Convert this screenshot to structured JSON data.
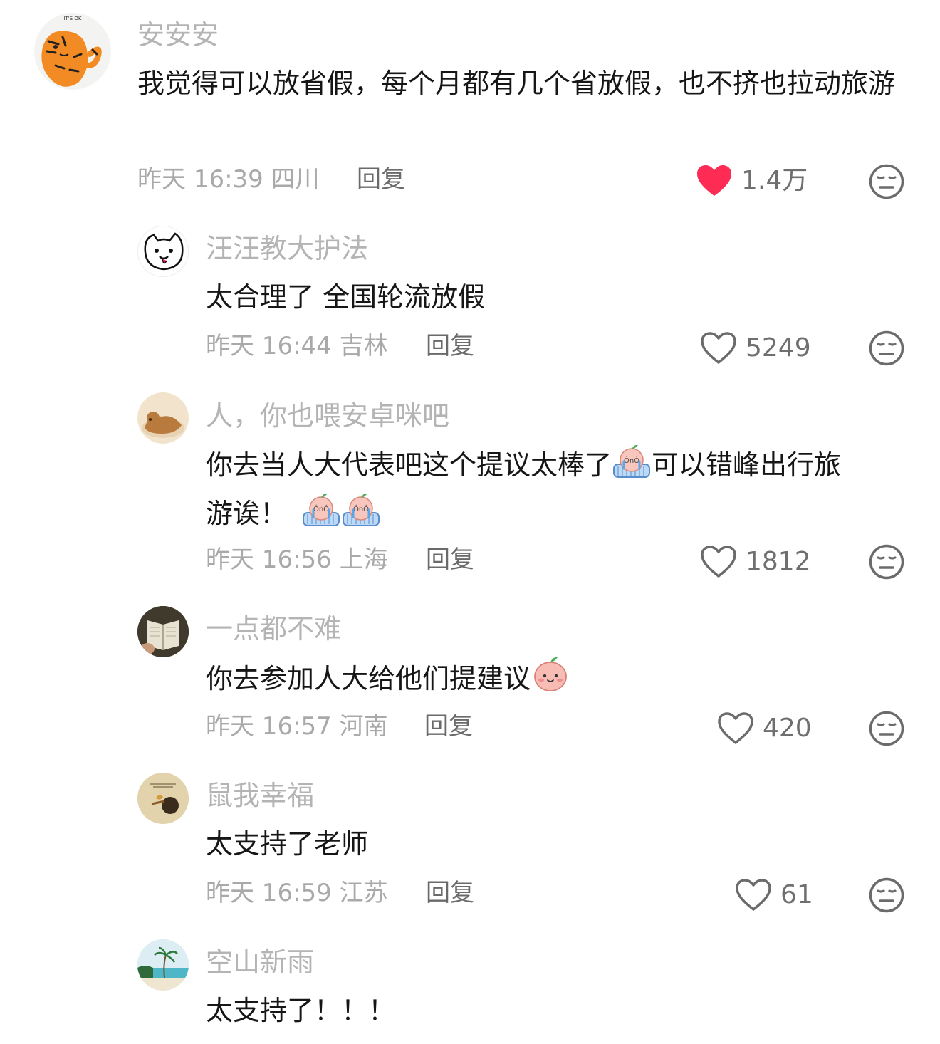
{
  "comments": [
    {
      "username": "安安安",
      "text": "我觉得可以放省假，每个月都有几个省放假，也不挤也拉动旅游",
      "time": "昨天 16:39",
      "location": "四川",
      "reply_label": "回复",
      "likes": "1.4万",
      "liked": true,
      "avatar_text": "IT'S OK"
    },
    {
      "username": "汪汪教大护法",
      "text": "太合理了 全国轮流放假",
      "time": "昨天 16:44",
      "location": "吉林",
      "reply_label": "回复",
      "likes": "5249",
      "liked": false
    },
    {
      "username": "人，你也喂安卓咪吧",
      "text_a": "你去当人大代表吧这个提议太棒了",
      "text_b": "可以错峰出行旅",
      "text_c": "游诶！",
      "time": "昨天 16:56",
      "location": "上海",
      "reply_label": "回复",
      "likes": "1812",
      "liked": false
    },
    {
      "username": "一点都不难",
      "text": "你去参加人大给他们提建议",
      "time": "昨天 16:57",
      "location": "河南",
      "reply_label": "回复",
      "likes": "420",
      "liked": false
    },
    {
      "username": "鼠我幸福",
      "text": "太支持了老师",
      "time": "昨天 16:59",
      "location": "江苏",
      "reply_label": "回复",
      "likes": "61",
      "liked": false
    },
    {
      "username": "空山新雨",
      "text": "太支持了！！！"
    }
  ],
  "colors": {
    "liked_heart": "#fe2c55",
    "username": "#b4b4b4",
    "text": "#161616",
    "meta": "#a9a9a9"
  },
  "icons": {
    "like": "heart-icon",
    "dislike": "unamused-face-icon",
    "crying_emoji": "crying-peach-emoji",
    "smile_emoji": "blushing-peach-emoji"
  }
}
